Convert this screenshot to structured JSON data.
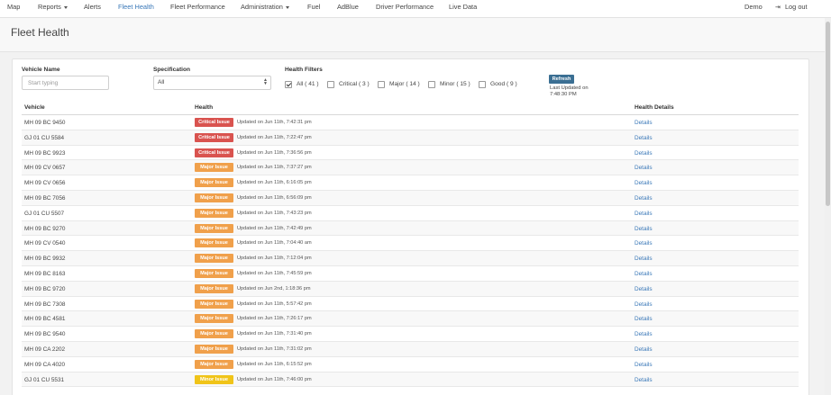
{
  "nav": {
    "items": [
      {
        "label": "Map",
        "caret": false,
        "active": false
      },
      {
        "label": "Reports",
        "caret": true,
        "active": false
      },
      {
        "label": "Alerts",
        "caret": false,
        "active": false
      },
      {
        "label": "Fleet Health",
        "caret": false,
        "active": true
      },
      {
        "label": "Fleet Performance",
        "caret": false,
        "active": false
      },
      {
        "label": "Administration",
        "caret": true,
        "active": false
      },
      {
        "label": "Fuel",
        "caret": false,
        "active": false
      },
      {
        "label": "AdBlue",
        "caret": false,
        "active": false
      },
      {
        "label": "Driver Performance",
        "caret": false,
        "active": false
      },
      {
        "label": "Live Data",
        "caret": false,
        "active": false
      }
    ],
    "user": "Demo",
    "logout": "Log out"
  },
  "page": {
    "title": "Fleet Health"
  },
  "filters": {
    "vehicle_name_label": "Vehicle Name",
    "vehicle_name_placeholder": "Start typing",
    "specification_label": "Specification",
    "specification_value": "All",
    "health_filters_label": "Health Filters",
    "options": [
      {
        "label": "All ( 41 )",
        "checked": true
      },
      {
        "label": "Critical ( 3 )",
        "checked": false
      },
      {
        "label": "Major ( 14 )",
        "checked": false
      },
      {
        "label": "Minor ( 15 )",
        "checked": false
      },
      {
        "label": "Good ( 9 )",
        "checked": false
      }
    ],
    "refresh_label": "Refresh",
    "last_updated_label": "Last Updated on",
    "last_updated_time": "7:48:30 PM"
  },
  "table": {
    "headers": {
      "vehicle": "Vehicle",
      "health": "Health",
      "details": "Health Details"
    },
    "details_label": "Details",
    "rows": [
      {
        "vehicle": "MH 09 BC 9450",
        "status": "Critical Issue",
        "level": "critical",
        "updated": "Updated on Jun 11th, 7:42:31 pm"
      },
      {
        "vehicle": "GJ 01 CU 5584",
        "status": "Critical Issue",
        "level": "critical",
        "updated": "Updated on Jun 11th, 7:22:47 pm"
      },
      {
        "vehicle": "MH 09 BC 9923",
        "status": "Critical Issue",
        "level": "critical",
        "updated": "Updated on Jun 11th, 7:36:56 pm"
      },
      {
        "vehicle": "MH 09 CV 0657",
        "status": "Major Issue",
        "level": "major",
        "updated": "Updated on Jun 11th, 7:37:27 pm"
      },
      {
        "vehicle": "MH 09 CV 0656",
        "status": "Major Issue",
        "level": "major",
        "updated": "Updated on Jun 11th, 6:16:05 pm"
      },
      {
        "vehicle": "MH 09 BC 7056",
        "status": "Major Issue",
        "level": "major",
        "updated": "Updated on Jun 11th, 6:56:09 pm"
      },
      {
        "vehicle": "GJ 01 CU 5507",
        "status": "Major Issue",
        "level": "major",
        "updated": "Updated on Jun 11th, 7:43:23 pm"
      },
      {
        "vehicle": "MH 09 BC 9270",
        "status": "Major Issue",
        "level": "major",
        "updated": "Updated on Jun 11th, 7:42:49 pm"
      },
      {
        "vehicle": "MH 09 CV 0540",
        "status": "Major Issue",
        "level": "major",
        "updated": "Updated on Jun 11th, 7:04:40 am"
      },
      {
        "vehicle": "MH 09 BC 9932",
        "status": "Major Issue",
        "level": "major",
        "updated": "Updated on Jun 11th, 7:12:04 pm"
      },
      {
        "vehicle": "MH 09 BC 8163",
        "status": "Major Issue",
        "level": "major",
        "updated": "Updated on Jun 11th, 7:45:59 pm"
      },
      {
        "vehicle": "MH 09 BC 9720",
        "status": "Major Issue",
        "level": "major",
        "updated": "Updated on Jun 2nd, 1:18:36 pm"
      },
      {
        "vehicle": "MH 09 BC 7308",
        "status": "Major Issue",
        "level": "major",
        "updated": "Updated on Jun 11th, 5:57:42 pm"
      },
      {
        "vehicle": "MH 09 BC 4581",
        "status": "Major Issue",
        "level": "major",
        "updated": "Updated on Jun 11th, 7:26:17 pm"
      },
      {
        "vehicle": "MH 09 BC 9540",
        "status": "Major Issue",
        "level": "major",
        "updated": "Updated on Jun 11th, 7:31:40 pm"
      },
      {
        "vehicle": "MH 09 CA 2202",
        "status": "Major Issue",
        "level": "major",
        "updated": "Updated on Jun 11th, 7:31:02 pm"
      },
      {
        "vehicle": "MH 09 CA 4020",
        "status": "Major Issue",
        "level": "major",
        "updated": "Updated on Jun 11th, 6:15:52 pm"
      },
      {
        "vehicle": "GJ 01 CU 5531",
        "status": "Minor Issue",
        "level": "minor",
        "updated": "Updated on Jun 11th, 7:46:00 pm"
      }
    ]
  },
  "colors": {
    "critical": "#d9534f",
    "major": "#f0a04b",
    "minor": "#f0c419",
    "link": "#3a78b8",
    "refresh": "#3b6f93"
  }
}
